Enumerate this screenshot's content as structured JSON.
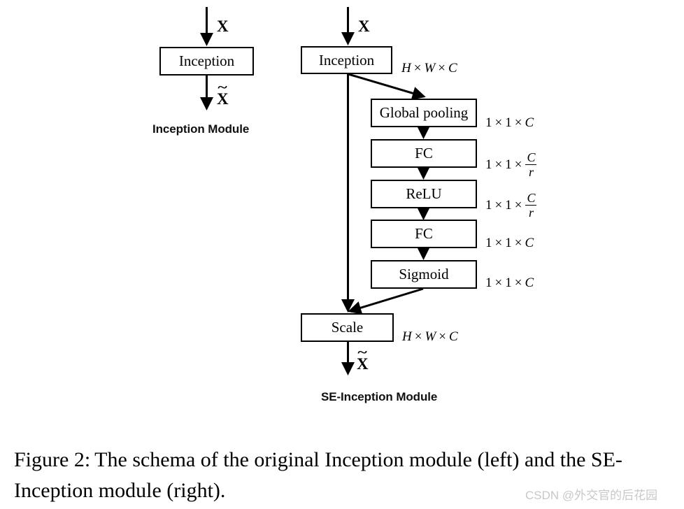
{
  "figure": {
    "background": "#ffffff",
    "stroke_color": "#000000",
    "legend_lead": "Figure 2:",
    "legend_text": "The schema of the original Inception module (left) and the SE-Inception module (right)."
  },
  "watermark": {
    "text": "CSDN @外交官的后花园",
    "color": "#c8c8c8"
  },
  "left_module": {
    "caption": "Inception Module",
    "input_label": "X",
    "output_label": "X",
    "output_accent": "~",
    "blocks": [
      {
        "label": "Inception"
      }
    ]
  },
  "right_module": {
    "caption": "SE-Inception Module",
    "input_label": "X",
    "output_label": "X",
    "output_accent": "~",
    "blocks": [
      {
        "label": "Inception",
        "dim": "H_W_C"
      },
      {
        "label": "Global pooling",
        "dim": "1_1_C"
      },
      {
        "label": "FC",
        "dim": "1_1_C_over_r"
      },
      {
        "label": "ReLU",
        "dim": "1_1_C_over_r"
      },
      {
        "label": "FC",
        "dim": "1_1_C"
      },
      {
        "label": "Sigmoid",
        "dim": "1_1_C"
      },
      {
        "label": "Scale",
        "dim": "H_W_C"
      }
    ]
  },
  "dims": {
    "H_W_C": {
      "a": "H",
      "b": "W",
      "c": "C",
      "times": "×"
    },
    "1_1_C": {
      "a": "1",
      "b": "1",
      "c": "C",
      "times": "×"
    },
    "1_1_C_over_r": {
      "a": "1",
      "b": "1",
      "num": "C",
      "den": "r",
      "times": "×"
    }
  }
}
